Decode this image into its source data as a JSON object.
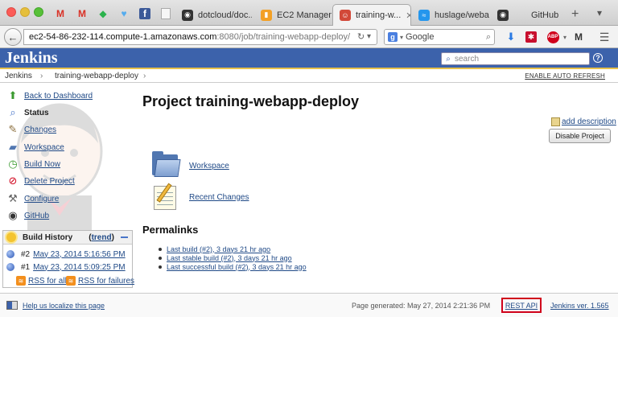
{
  "browser": {
    "tabs": [
      {
        "label": "",
        "icon": "gmail-icon",
        "color": "#d93025",
        "glyph": "M"
      },
      {
        "label": "",
        "icon": "gmail-icon",
        "color": "#d93025",
        "glyph": "M"
      },
      {
        "label": "",
        "icon": "feedly-icon",
        "color": "#2bb24c",
        "glyph": "f"
      },
      {
        "label": "",
        "icon": "twitter-icon",
        "color": "#55acee",
        "glyph": "t"
      },
      {
        "label": "",
        "icon": "facebook-icon",
        "color": "#3b5998",
        "glyph": "f"
      },
      {
        "label": "",
        "icon": "blank-page-icon",
        "color": "#dddddd",
        "glyph": ""
      },
      {
        "label": "dotcloud/doc...",
        "icon": "github-icon",
        "color": "#333333",
        "glyph": "◉"
      },
      {
        "label": "EC2 Managem...",
        "icon": "aws-icon",
        "color": "#f3a025",
        "glyph": "▮"
      },
      {
        "label": "training-w...",
        "icon": "jenkins-icon",
        "color": "#d24939",
        "glyph": "☺",
        "active": true
      },
      {
        "label": "huslage/weba...",
        "icon": "docker-icon",
        "color": "#2496ed",
        "glyph": "≈"
      },
      {
        "label": "GitHub",
        "icon": "github-icon",
        "color": "#333333",
        "glyph": "◉"
      }
    ],
    "url": {
      "host": "ec2-54-86-232-114.compute-1.amazonaws.com",
      "path": ":8080/job/training-webapp-deploy/"
    },
    "search_placeholder": "Google"
  },
  "jenkins": {
    "logo": "Jenkins",
    "search_placeholder": "search",
    "help": "?",
    "breadcrumb": [
      "Jenkins",
      "training-webapp-deploy"
    ],
    "auto_refresh": "ENABLE AUTO REFRESH",
    "tasks": [
      {
        "label": "Back to Dashboard",
        "icon": "up-arrow-icon",
        "glyph": "⬆",
        "color": "#3a9a2f"
      },
      {
        "label": "Status",
        "icon": "magnifier-icon",
        "glyph": "🔍",
        "color": "#4a76c9",
        "current": true
      },
      {
        "label": "Changes",
        "icon": "notepad-icon",
        "glyph": "✎",
        "color": "#8a6d3b"
      },
      {
        "label": "Workspace",
        "icon": "folder-icon",
        "glyph": "▰",
        "color": "#5177b1"
      },
      {
        "label": "Build Now",
        "icon": "clock-icon",
        "glyph": "◷",
        "color": "#3a9a2f"
      },
      {
        "label": "Delete Project",
        "icon": "no-entry-icon",
        "glyph": "⊘",
        "color": "#d0021b"
      },
      {
        "label": "Configure",
        "icon": "wrench-icon",
        "glyph": "✂",
        "color": "#666666"
      },
      {
        "label": "GitHub",
        "icon": "github-icon",
        "glyph": "◉",
        "color": "#333333"
      }
    ],
    "build_history": {
      "title": "Build History",
      "trend_open": "(",
      "trend": "trend",
      "trend_close": ")",
      "builds": [
        {
          "number": "#2",
          "date": "May 23, 2014 5:16:56 PM"
        },
        {
          "number": "#1",
          "date": "May 23, 2014 5:09:25 PM"
        }
      ],
      "rss_all": "RSS for all",
      "rss_failures": "RSS for failures"
    },
    "project_title": "Project training-webapp-deploy",
    "add_description": "add description",
    "disable_button": "Disable Project",
    "main_links": [
      {
        "label": "Workspace",
        "icon": "folder-icon"
      },
      {
        "label": "Recent Changes",
        "icon": "notepad-icon"
      }
    ],
    "permalinks_title": "Permalinks",
    "permalinks": [
      "Last build (#2), 3 days 21 hr ago",
      "Last stable build (#2), 3 days 21 hr ago",
      "Last successful build (#2), 3 days 21 hr ago"
    ],
    "footer": {
      "localize": "Help us localize this page",
      "page_generated": "Page generated: May 27, 2014 2:21:36 PM",
      "rest_api": "REST API",
      "version": "Jenkins ver. 1.565"
    }
  }
}
